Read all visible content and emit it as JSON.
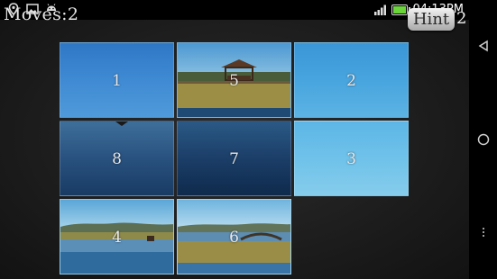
{
  "game": {
    "moves_label": "Moves:2",
    "hint_label": "Hint",
    "hint_count": "2"
  },
  "statusbar": {
    "time": "04:13PM",
    "battery_level": 0.86,
    "left_icons": [
      "location-icon",
      "image-icon",
      "android-icon"
    ],
    "right_icons": [
      "signal-icon",
      "battery-icon"
    ]
  },
  "tiles": [
    {
      "label": "1"
    },
    {
      "label": "5"
    },
    {
      "label": "2"
    },
    {
      "label": "8"
    },
    {
      "label": "7"
    },
    {
      "label": "3"
    },
    {
      "label": "4"
    },
    {
      "label": "6"
    }
  ],
  "navbar": {
    "icons": [
      "back-icon",
      "home-icon",
      "menu-icon"
    ]
  },
  "colors": {
    "board_background": "#1b1b1b",
    "battery_green": "#6bd43a",
    "hint_button": "#d9d9d9"
  }
}
